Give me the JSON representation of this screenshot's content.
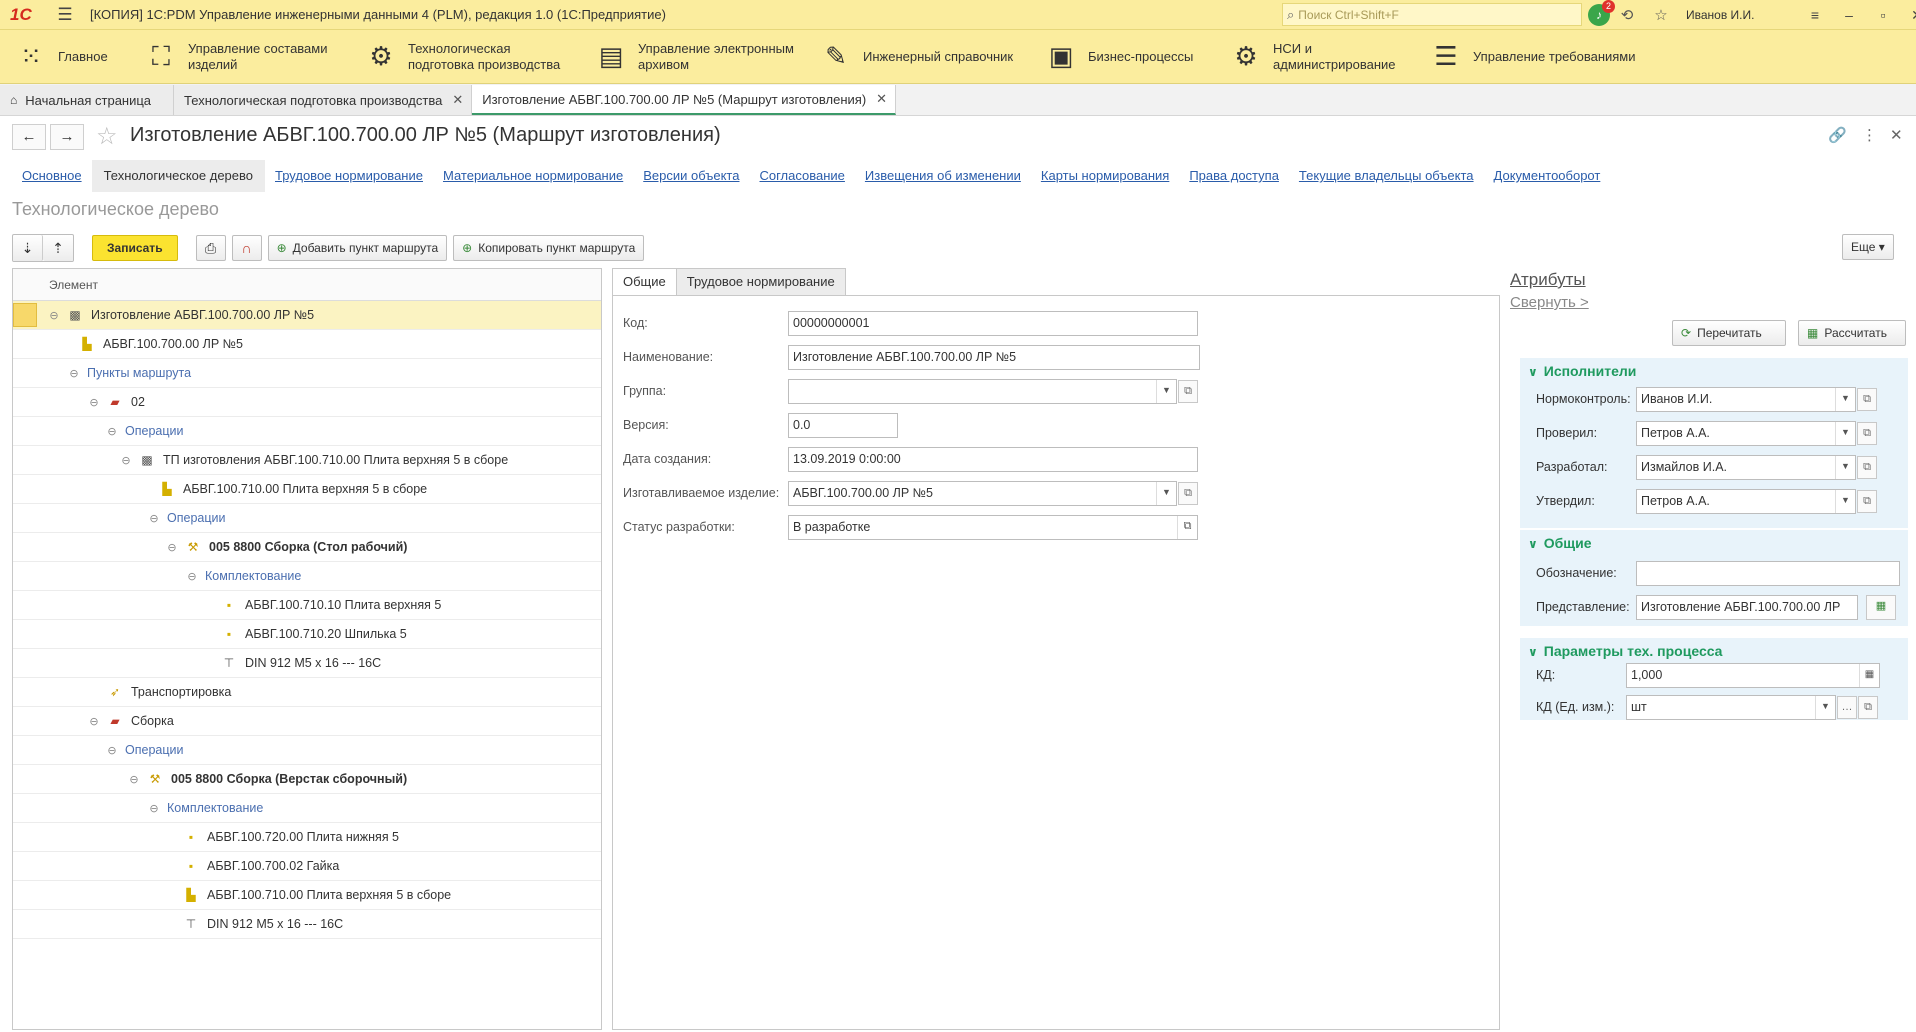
{
  "window": {
    "logo": "1С",
    "title": "[КОПИЯ] 1С:PDM Управление инженерными данными 4 (PLM), редакция 1.0  (1С:Предприятие)",
    "search_placeholder": "Поиск Ctrl+Shift+F",
    "notifications_count": "2",
    "user": "Иванов И.И."
  },
  "sections": [
    {
      "label": "Главное",
      "icon": "grid-icon"
    },
    {
      "label": "Управление составами\nизделий",
      "icon": "structure-icon"
    },
    {
      "label": "Технологическая\nподготовка производства",
      "icon": "gear-icon"
    },
    {
      "label": "Управление электронным\nархивом",
      "icon": "archive-icon"
    },
    {
      "label": "Инженерный справочник",
      "icon": "wrench-icon"
    },
    {
      "label": "Бизнес-процессы",
      "icon": "process-icon"
    },
    {
      "label": "НСИ и\nадминистрирование",
      "icon": "settings-icon"
    },
    {
      "label": "Управление требованиями",
      "icon": "requirements-icon"
    }
  ],
  "open_tabs": [
    {
      "label": "Начальная страница"
    },
    {
      "label": "Технологическая подготовка производства"
    },
    {
      "label": "Изготовление АБВГ.100.700.00 ЛР №5 (Маршрут изготовления)"
    }
  ],
  "form": {
    "title": "Изготовление АБВГ.100.700.00 ЛР №5 (Маршрут изготовления)",
    "links": [
      "Основное",
      "Технологическое дерево",
      "Трудовое нормирование",
      "Материальное нормирование",
      "Версии объекта",
      "Согласование",
      "Извещения об изменении",
      "Карты нормирования",
      "Права доступа",
      "Текущие владельцы объекта",
      "Документооборот"
    ],
    "page_title": "Технологическое дерево"
  },
  "toolbar": {
    "save": "Записать",
    "add_point": "Добавить пункт маршрута",
    "copy_point": "Копировать пункт маршрута",
    "more": "Еще"
  },
  "tree": {
    "header": "Элемент",
    "rows": [
      {
        "text": "Изготовление АБВГ.100.700.00 ЛР №5"
      },
      {
        "text": "АБВГ.100.700.00 ЛР №5"
      },
      {
        "text": "Пункты маршрута"
      },
      {
        "text": "02"
      },
      {
        "text": "Операции"
      },
      {
        "text": "ТП изготовления АБВГ.100.710.00 Плита верхняя 5 в сборе"
      },
      {
        "text": "АБВГ.100.710.00 Плита верхняя 5 в сборе"
      },
      {
        "text": "Операции"
      },
      {
        "text": "005 8800 Сборка (Стол рабочий)"
      },
      {
        "text": "Комплектование"
      },
      {
        "text": "АБВГ.100.710.10 Плита верхняя 5"
      },
      {
        "text": "АБВГ.100.710.20 Шпилька 5"
      },
      {
        "text": "DIN 912 M5 x 16 --- 16C"
      },
      {
        "text": "Транспортировка"
      },
      {
        "text": "Сборка"
      },
      {
        "text": "Операции"
      },
      {
        "text": "005 8800 Сборка (Верстак сборочный)"
      },
      {
        "text": "Комплектование"
      },
      {
        "text": "АБВГ.100.720.00 Плита нижняя 5"
      },
      {
        "text": "АБВГ.100.700.02 Гайка"
      },
      {
        "text": "АБВГ.100.710.00 Плита верхняя 5 в сборе"
      },
      {
        "text": "DIN 912 M5 x 16 --- 16C"
      }
    ]
  },
  "details": {
    "tabs": [
      "Общие",
      "Трудовое нормирование"
    ],
    "fields": [
      {
        "label": "Код:",
        "value": "00000000001"
      },
      {
        "label": "Наименование:",
        "value": "Изготовление АБВГ.100.700.00 ЛР №5"
      },
      {
        "label": "Группа:",
        "value": ""
      },
      {
        "label": "Версия:",
        "value": "0.0"
      },
      {
        "label": "Дата создания:",
        "value": "13.09.2019 0:00:00"
      },
      {
        "label": "Изготавливаемое изделие:",
        "value": "АБВГ.100.700.00 ЛР №5"
      },
      {
        "label": "Статус разработки:",
        "value": "В разработке"
      }
    ]
  },
  "attributes": {
    "title": "Атрибуты",
    "collapse": "Свернуть >",
    "reread": "Перечитать",
    "calculate": "Рассчитать",
    "executors": {
      "title": "Исполнители",
      "rows": [
        {
          "label": "Нормоконтроль:",
          "value": "Иванов И.И."
        },
        {
          "label": "Проверил:",
          "value": "Петров А.А."
        },
        {
          "label": "Разработал:",
          "value": "Измайлов И.А."
        },
        {
          "label": "Утвердил:",
          "value": "Петров А.А."
        }
      ]
    },
    "general": {
      "title": "Общие",
      "designation_label": "Обозначение:",
      "designation_value": "",
      "representation_label": "Представление:",
      "representation_value": "Изготовление АБВГ.100.700.00 ЛР"
    },
    "params": {
      "title": "Параметры тех. процесса",
      "kd_label": "КД:",
      "kd_value": "1,000",
      "kd_unit_label": "КД (Ед. изм.):",
      "kd_unit_value": "шт"
    }
  },
  "colors": {
    "titlebar": "#fbed9e",
    "accent_green": "#1f9a5f",
    "save_button": "#fbe330",
    "link": "#2a5caa"
  }
}
